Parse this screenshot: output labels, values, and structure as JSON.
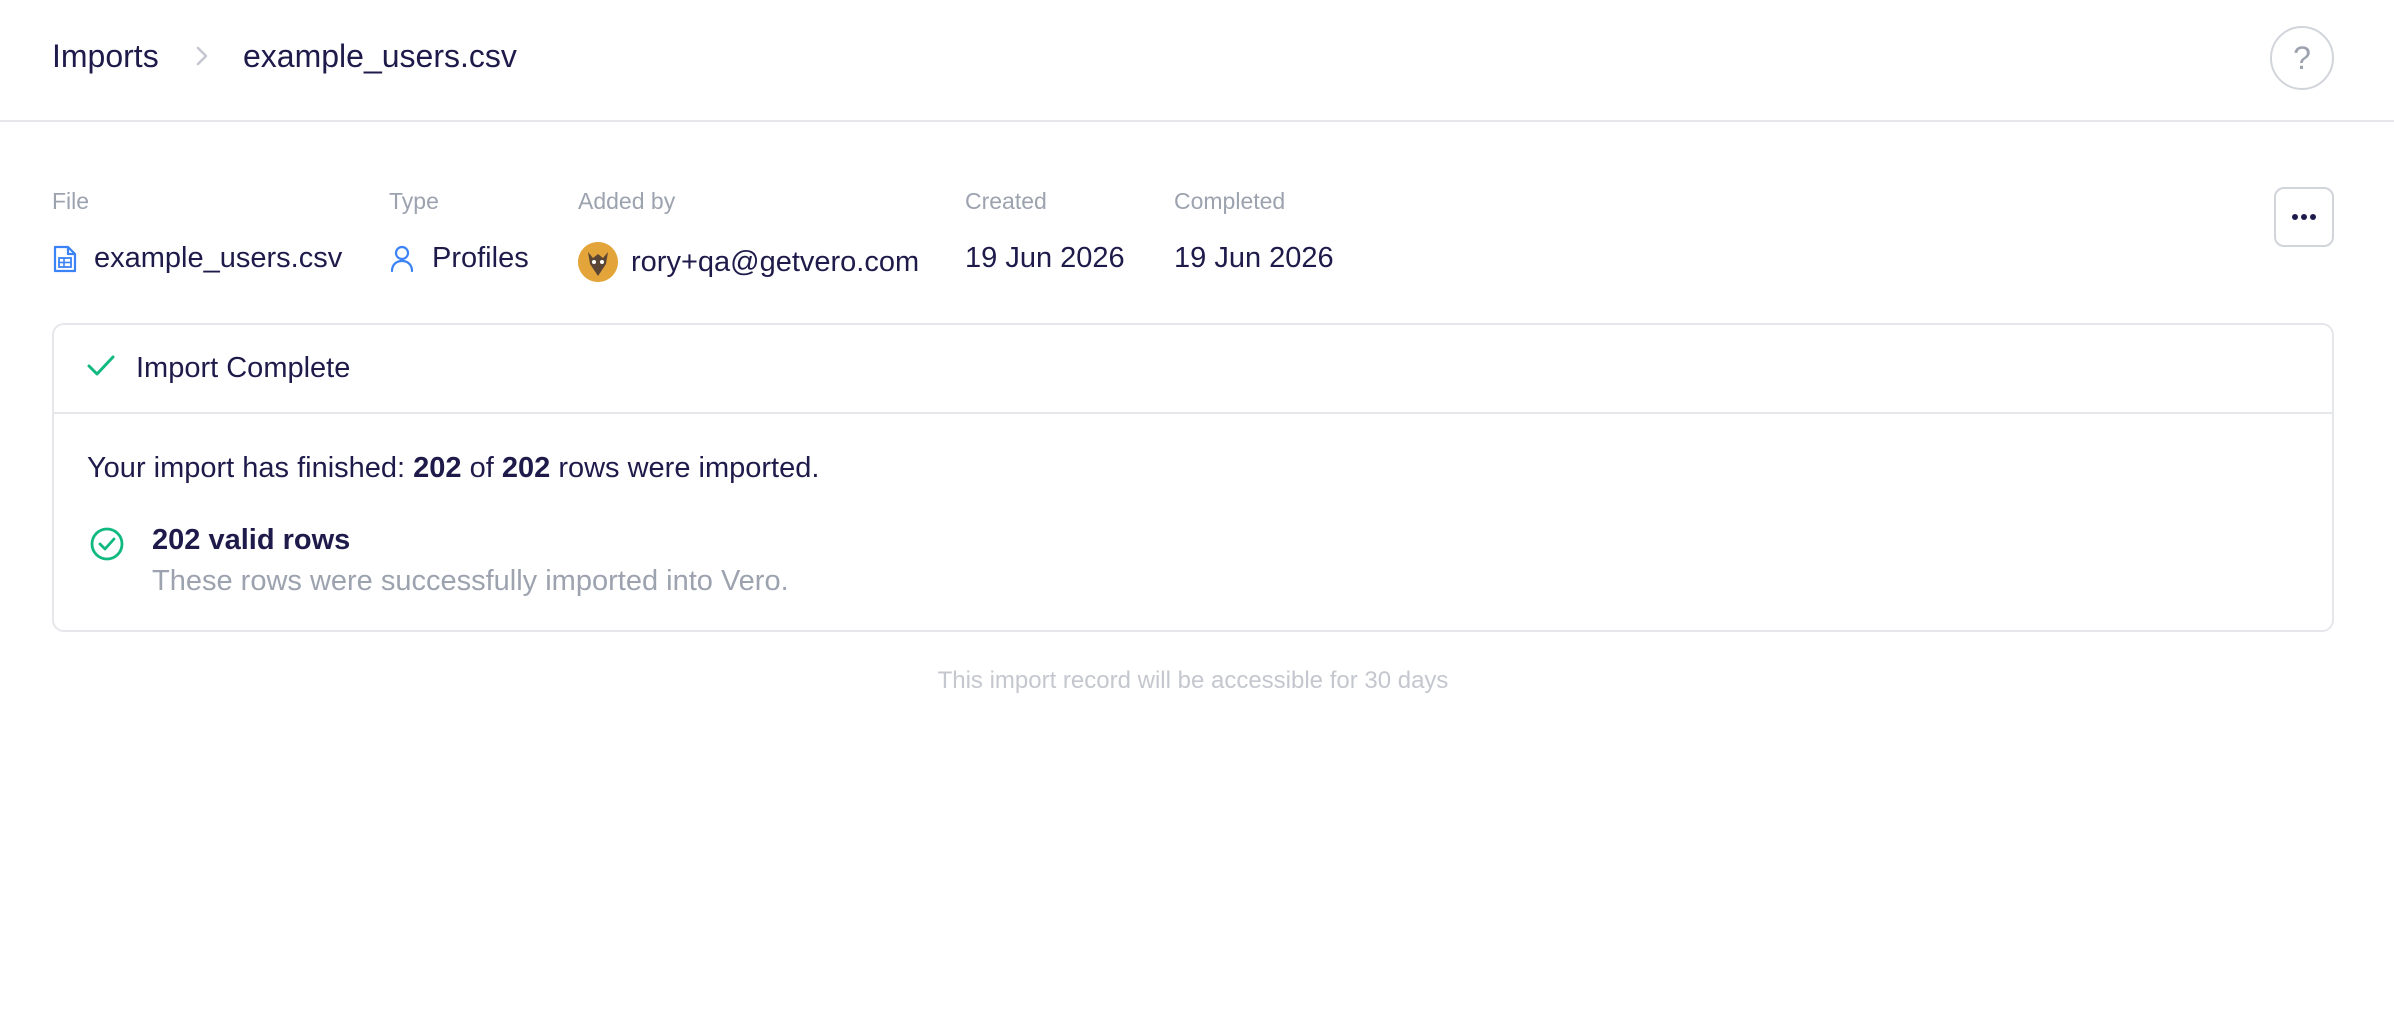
{
  "breadcrumb": {
    "root": "Imports",
    "current": "example_users.csv"
  },
  "help": {
    "label": "?"
  },
  "meta": {
    "file": {
      "label": "File",
      "value": "example_users.csv",
      "icon": "file-spreadsheet-icon"
    },
    "type": {
      "label": "Type",
      "value": "Profiles",
      "icon": "user-icon"
    },
    "added_by": {
      "label": "Added by",
      "value": "rory+qa@getvero.com",
      "icon": "avatar"
    },
    "created": {
      "label": "Created",
      "value": "19 Jun 2026"
    },
    "completed": {
      "label": "Completed",
      "value": "19 Jun 2026"
    }
  },
  "more_button": {
    "icon": "ellipsis-icon"
  },
  "card": {
    "title": "Import Complete",
    "summary": {
      "prefix": "Your import has finished: ",
      "imported": "202",
      "middle": " of ",
      "total": "202",
      "suffix": " rows were imported."
    },
    "valid": {
      "title": "202 valid rows",
      "subtitle": "These rows were successfully imported into Vero."
    }
  },
  "footer_note": "This import record will be accessible for 30 days",
  "colors": {
    "text": "#1e1b4b",
    "muted": "#9ca3af",
    "success": "#10b981",
    "link_icon": "#3b82f6"
  }
}
